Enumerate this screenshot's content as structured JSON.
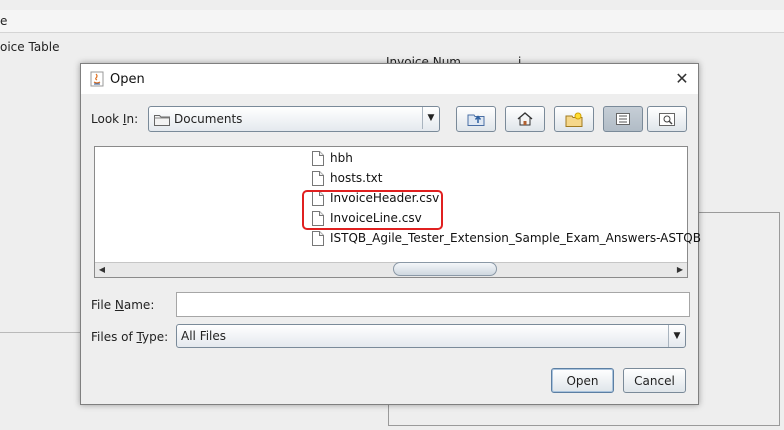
{
  "background": {
    "menu_fragment": "e",
    "table_label": "oice Table",
    "column_1": "Invoice Num",
    "column_2": "i"
  },
  "dialog": {
    "title": "Open",
    "close_glyph": "✕",
    "look_in_label_before": "Look ",
    "look_in_label_underlined": "I",
    "look_in_label_after": "n:",
    "look_in_value": "Documents",
    "toolbar_icons": [
      "up-one-level-icon",
      "home-icon",
      "new-folder-icon",
      "list-view-icon",
      "details-view-icon"
    ],
    "files": [
      "hbh",
      "hosts.txt",
      "InvoiceHeader.csv",
      "InvoiceLine.csv",
      "ISTQB_Agile_Tester_Extension_Sample_Exam_Answers-ASTQB"
    ],
    "file_name_label_before": "File ",
    "file_name_label_underlined": "N",
    "file_name_label_after": "ame:",
    "file_name_value": "",
    "files_of_type_label_before": "Files of ",
    "files_of_type_label_underlined": "T",
    "files_of_type_label_after": "ype:",
    "files_of_type_value": "All Files",
    "open_button": "Open",
    "cancel_button": "Cancel"
  },
  "colors": {
    "highlight": "#e02020",
    "accent": "#7a8a99"
  }
}
